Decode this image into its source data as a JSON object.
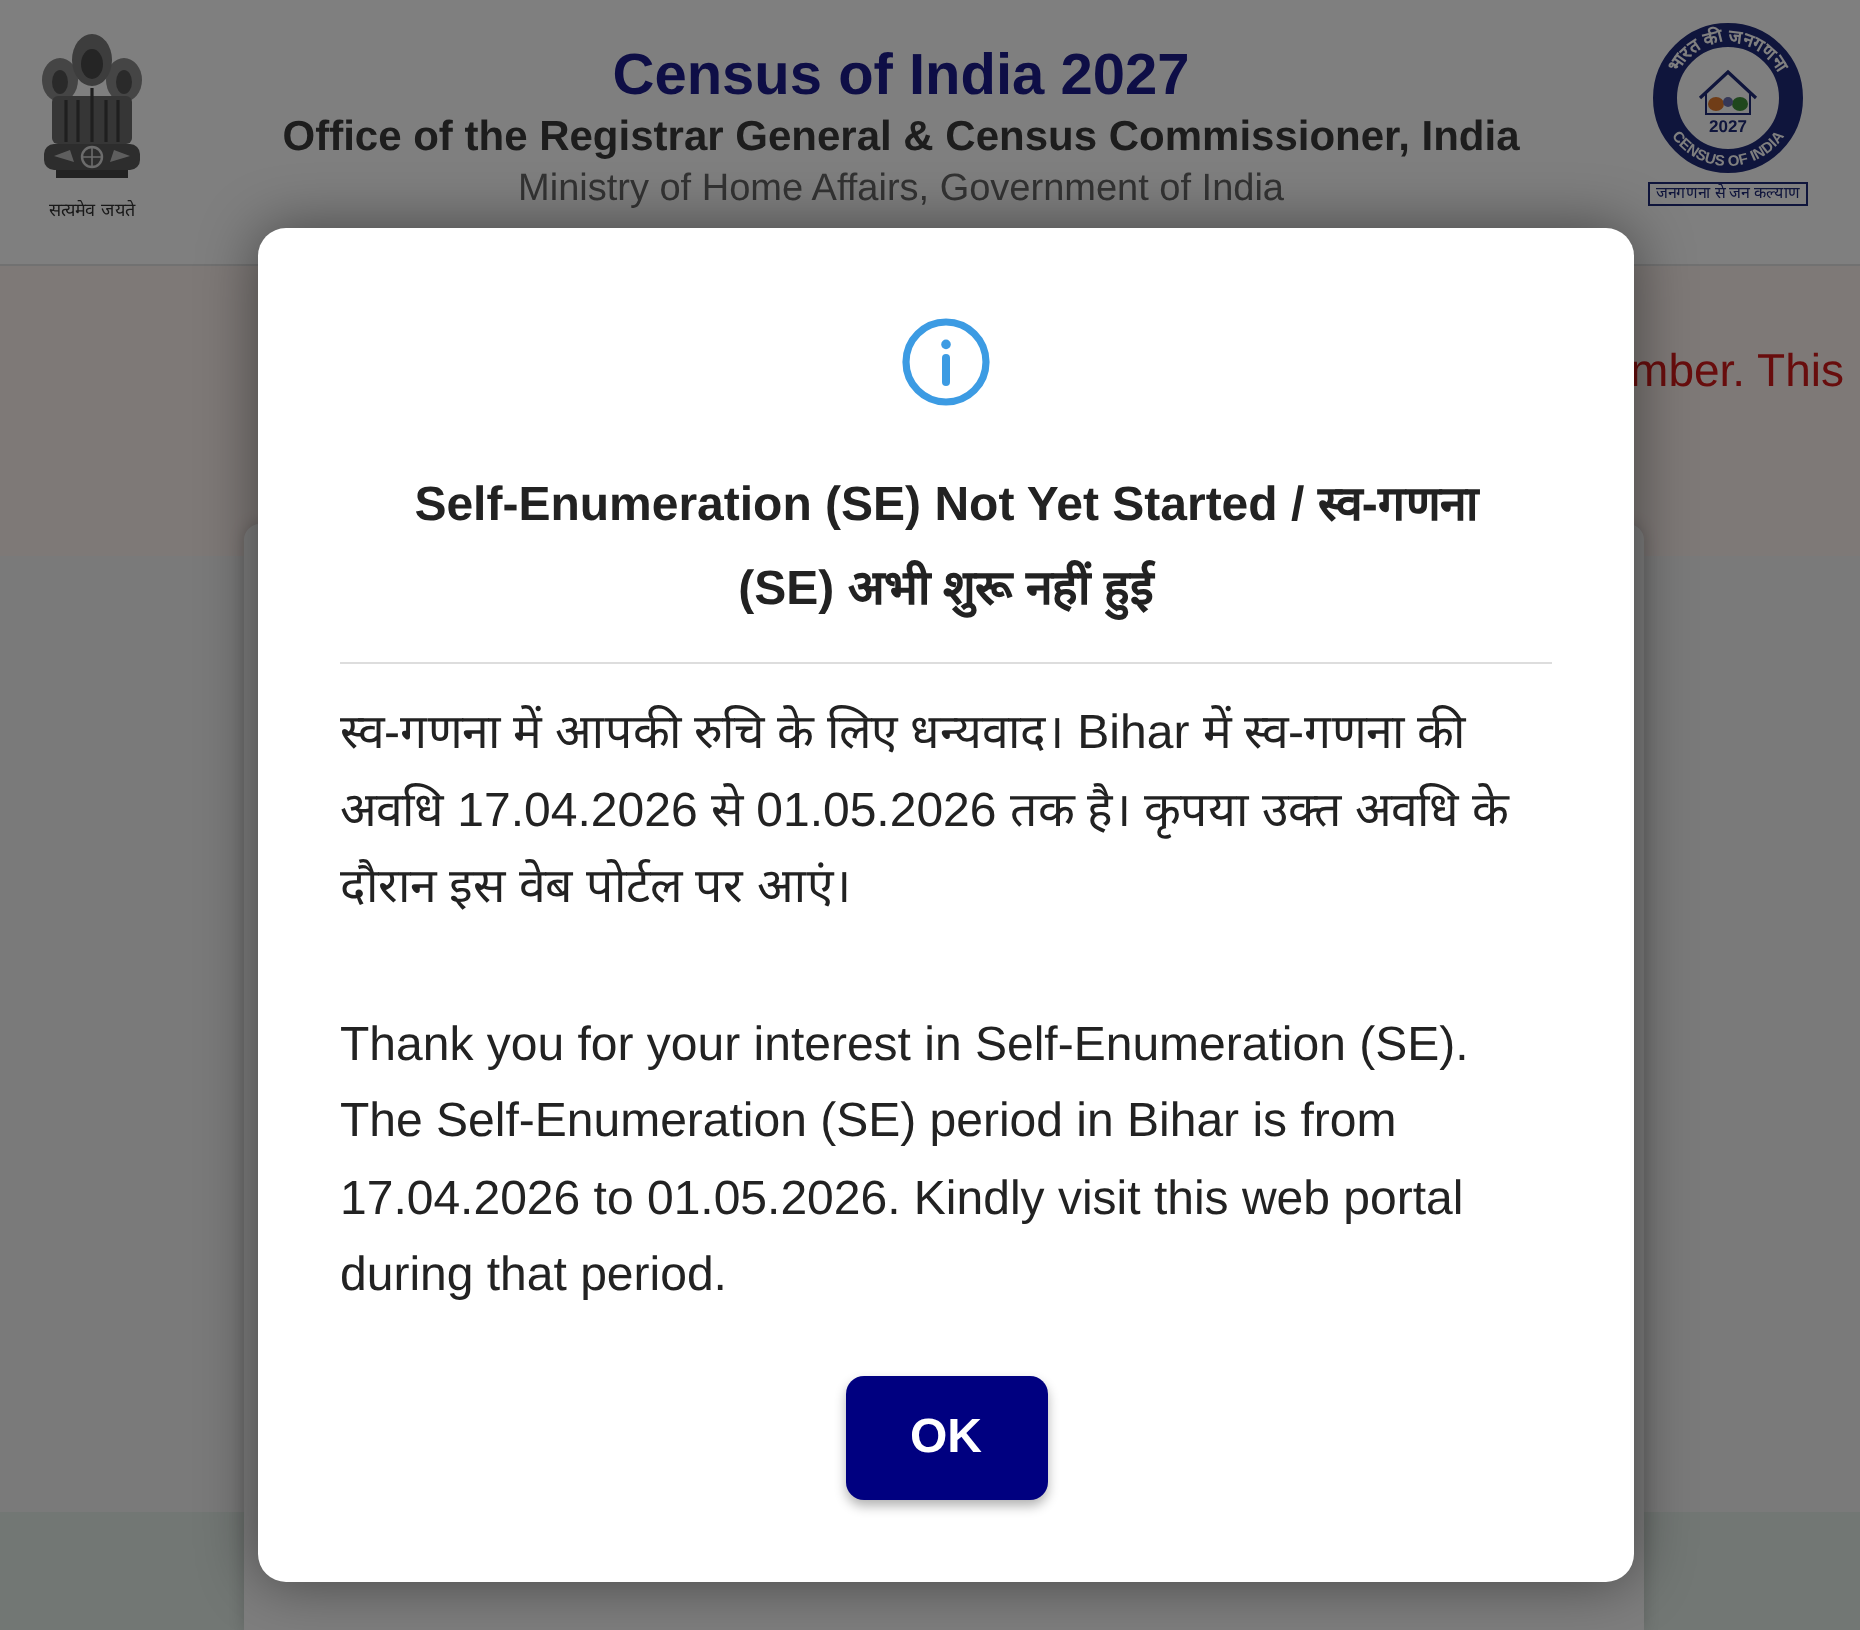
{
  "header": {
    "emblem": {
      "motto": "सत्यमेव जयते"
    },
    "title": "Census of India 2027",
    "subtitle": "Office of the Registrar General & Census Commissioner, India",
    "ministry": "Ministry of Home Affairs, Government of India",
    "logo": {
      "ring_top": "भारत की जनगणना",
      "year": "2027",
      "ring_bottom": "CENSUS OF INDIA",
      "tagline": "जनगणना से जन कल्याण"
    }
  },
  "notice": {
    "text": "mber. This"
  },
  "dialog": {
    "title": "Self-Enumeration (SE) Not Yet Started / स्व-गणना (SE) अभी शुरू नहीं हुई",
    "paragraphs": [
      "स्व-गणना में आपकी रुचि के लिए धन्यवाद। Bihar में स्व-गणना की अवधि 17.04.2026 से 01.05.2026 तक है। कृपया उक्त अवधि के दौरान इस वेब पोर्टल पर आएं।",
      "Thank you for your interest in Self-Enumeration (SE). The Self-Enumeration (SE) period in Bihar is from 17.04.2026 to 01.05.2026. Kindly visit this web portal during that period."
    ],
    "buttons": [
      {
        "label": "OK"
      }
    ]
  }
}
